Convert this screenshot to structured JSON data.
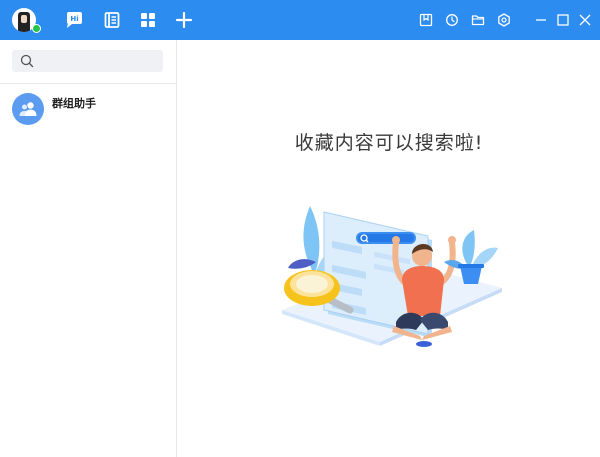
{
  "titlebar": {
    "bg_color": "#2c8cf0",
    "nav_icons": [
      "chat-bubble-icon",
      "notebook-icon",
      "apps-grid-icon",
      "plus-icon"
    ],
    "window_icons": [
      "bookmark-icon",
      "history-icon",
      "folder-icon",
      "gear-icon",
      "minimize-icon",
      "maximize-icon",
      "close-icon"
    ]
  },
  "user": {
    "status": "online",
    "status_color": "#27c24c"
  },
  "sidebar": {
    "search": {
      "placeholder": "",
      "value": ""
    },
    "items": [
      {
        "name": "群组助手",
        "icon": "group-users-icon",
        "avatar_color": "#5b9cf0"
      }
    ]
  },
  "main": {
    "empty_title": "收藏内容可以搜索啦!"
  }
}
